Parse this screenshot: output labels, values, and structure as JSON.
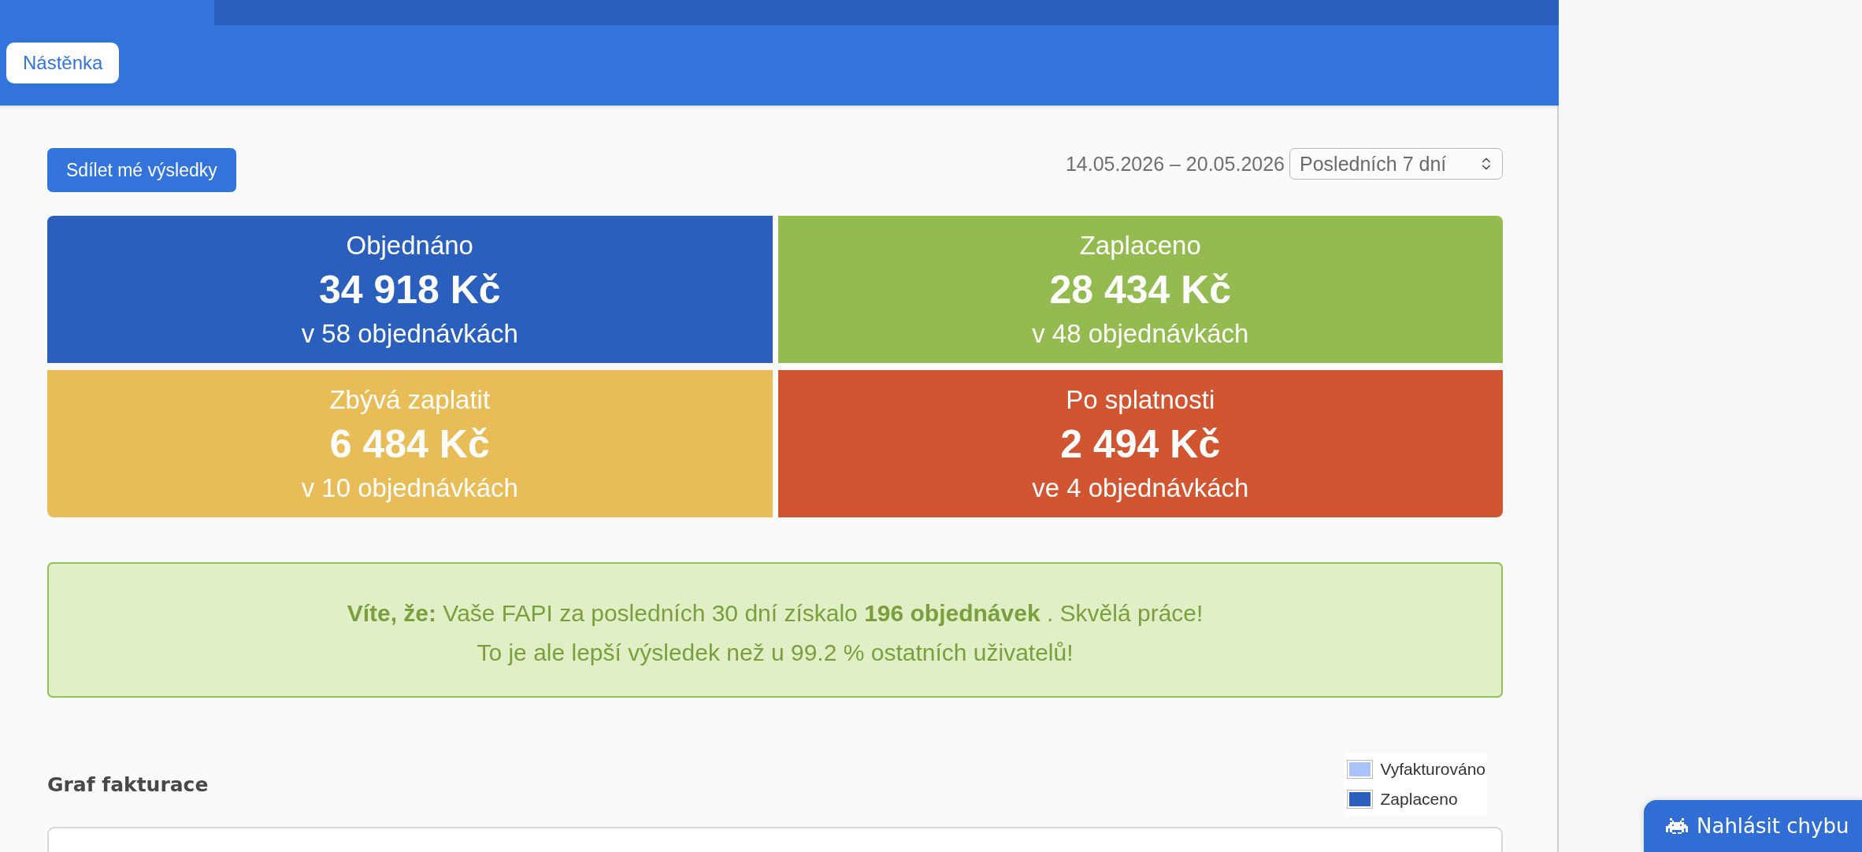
{
  "header": {
    "breadcrumb": "Nástěnka"
  },
  "toolbar": {
    "share_button": "Sdílet mé výsledky",
    "date_range": "14.05.2026 – 20.05.2026",
    "period_select": {
      "value": "Posledních 7 dní"
    }
  },
  "summary_cards": [
    {
      "title": "Objednáno",
      "amount": "34 918 Kč",
      "detail": "v 58 objednávkách",
      "color": "#2a5fbd"
    },
    {
      "title": "Zaplaceno",
      "amount": "28 434 Kč",
      "detail": "v 48 objednávkách",
      "color": "#94bb4f"
    },
    {
      "title": "Zbývá zaplatit",
      "amount": "6 484 Kč",
      "detail": "v 10 objednávkách",
      "color": "#e8bd58"
    },
    {
      "title": "Po splatnosti",
      "amount": "2 494 Kč",
      "detail": "ve 4 objednávkách",
      "color": "#d25532"
    }
  ],
  "info_box": {
    "lines": [
      "**Víte, že:** Vaše FAPI za posledních 30 dní získalo **196 objednávek** . Skvělá práce!",
      "To je ale lepší výsledek než u 99.2 % ostatních uživatelů!"
    ]
  },
  "chart": {
    "title": "Graf fakturace",
    "legend": [
      {
        "label": "Vyfakturováno",
        "color": "#a9c3fa"
      },
      {
        "label": "Zaplaceno",
        "color": "#2a5fbd"
      }
    ]
  },
  "report_button": {
    "label": "Nahlásit chybu"
  }
}
